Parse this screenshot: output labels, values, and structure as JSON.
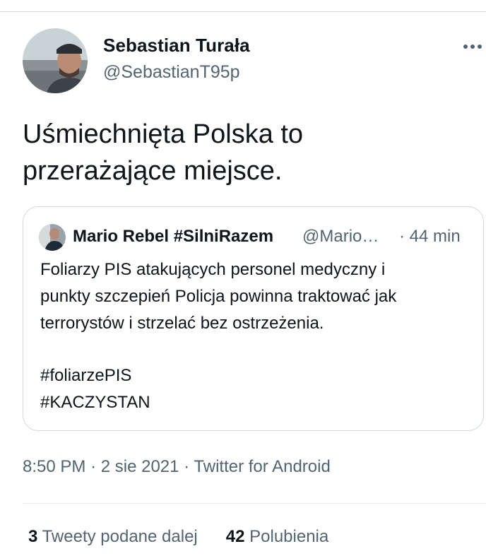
{
  "tweet": {
    "author_name": "Sebastian Turała",
    "author_handle": "@SebastianT95p",
    "more_icon": "more-horizontal-icon",
    "text_line1": "Uśmiechnięta Polska to",
    "text_line2": "przerażające miejsce.",
    "time": "8:50 PM",
    "date": "2 sie 2021",
    "source": "Twitter for Android",
    "sep": "·"
  },
  "quote": {
    "author_name": "Mario Rebel #SilniRazem",
    "author_handle": "@Mario…",
    "time": "· 44 min",
    "line1": "Foliarzy PIS atakujących personel medyczny i",
    "line2": "punkty szczepień Policja powinna traktować jak",
    "line3": "terrorystów i strzelać bez ostrzeżenia.",
    "hashtag1": "#foliarzePIS",
    "hashtag2": "#KACZYSTAN",
    "hashtag_color": "#0f1419"
  },
  "stats": {
    "retweets_count": "3",
    "retweets_label": "Tweety podane dalej",
    "likes_count": "42",
    "likes_label": "Polubienia"
  },
  "colors": {
    "primary_text": "#0f1419",
    "secondary_text": "#536471",
    "border": "#cfd9de"
  }
}
